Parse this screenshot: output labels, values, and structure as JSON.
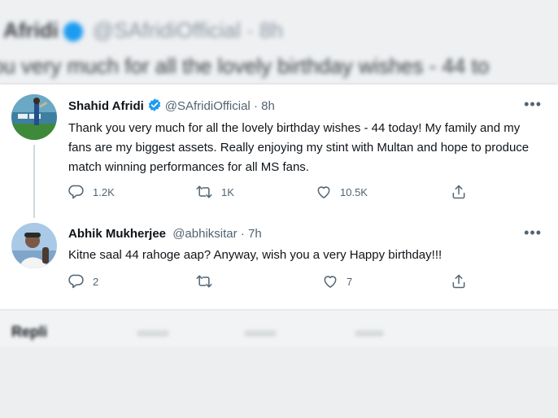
{
  "background": {
    "top_line1_name": "Afridi",
    "top_line1_handle": "@SAfridiOfficial · 8h",
    "top_line2_text": "ou very much for all the lovely birthday wishes - 44 to",
    "bottom_heading": "Repli"
  },
  "tweet1": {
    "author_name": "Shahid Afridi",
    "handle": "@SAfridiOfficial",
    "separator": "·",
    "time": "8h",
    "more_label": "•••",
    "text": "Thank you very much for all the lovely birthday wishes - 44 today! My family and my fans are my biggest assets. Really enjoying my stint with Multan and hope to produce match winning performances for all MS fans.",
    "replies": "1.2K",
    "retweets": "1K",
    "likes": "10.5K"
  },
  "tweet2": {
    "author_name": "Abhik Mukherjee",
    "handle": "@abhiksitar",
    "separator": "·",
    "time": "7h",
    "more_label": "•••",
    "text": "Kitne saal 44 rahoge aap? Anyway, wish you a very Happy birthday!!!",
    "replies": "2",
    "retweets": "",
    "likes": "7"
  },
  "colors": {
    "verified_blue": "#1d9bf0",
    "text_primary": "#0f1419",
    "text_secondary": "#536471",
    "thread_line": "#cfd9de"
  },
  "icons": [
    "verified-badge-icon",
    "reply-icon",
    "retweet-icon",
    "like-icon",
    "share-icon",
    "more-icon"
  ]
}
